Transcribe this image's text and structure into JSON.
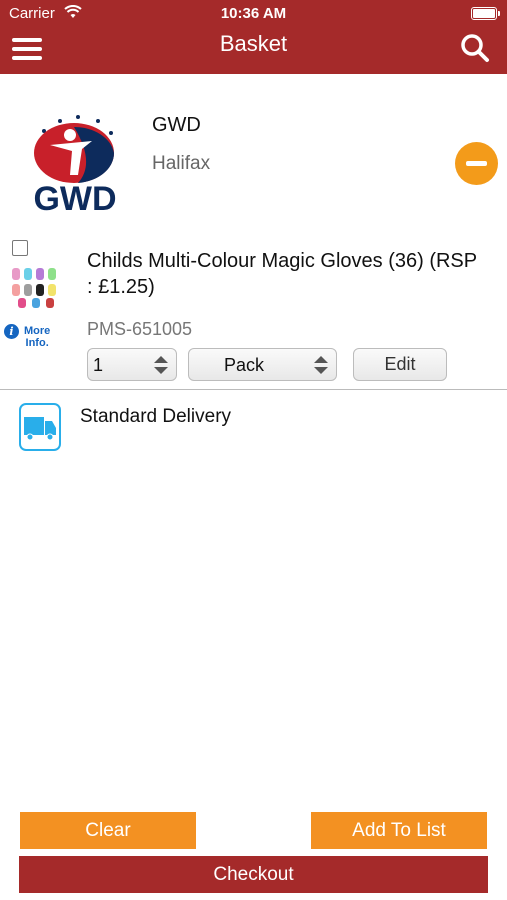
{
  "status_bar": {
    "carrier": "Carrier",
    "time": "10:36 AM"
  },
  "header": {
    "title": "Basket"
  },
  "retailer": {
    "name": "GWD",
    "location": "Halifax",
    "logo_text": "GWD"
  },
  "item": {
    "title": "Childs Multi-Colour Magic Gloves (36) (RSP : £1.25)",
    "code": "PMS-651005",
    "quantity": "1",
    "unit": "Pack",
    "edit_label": "Edit",
    "more_info_line1": "More",
    "more_info_line2": "Info."
  },
  "delivery": {
    "label": "Standard Delivery"
  },
  "actions": {
    "clear": "Clear",
    "add_to_list": "Add To List",
    "checkout": "Checkout"
  },
  "colors": {
    "header": "#a52a2a",
    "accent": "#f39122",
    "link": "#1565c0"
  }
}
